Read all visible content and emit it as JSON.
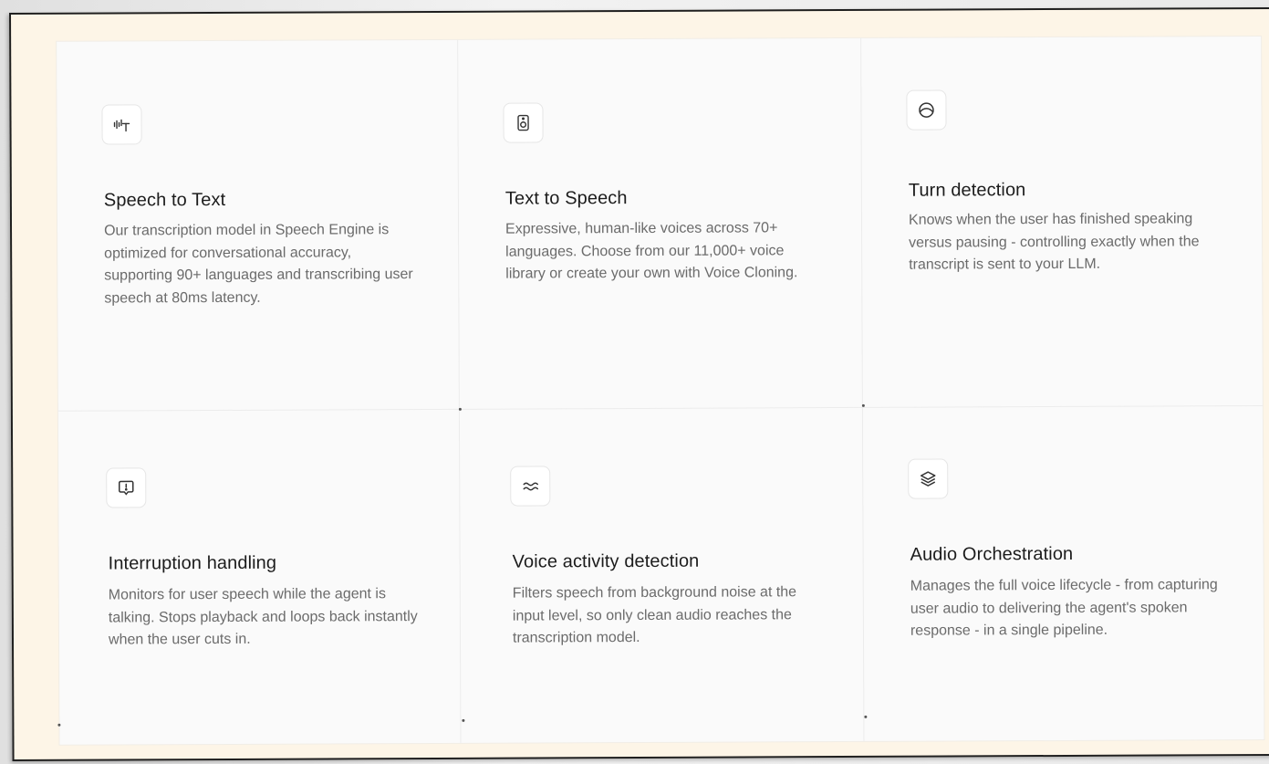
{
  "features": [
    {
      "icon": "speech-to-text-icon",
      "title": "Speech to Text",
      "description": "Our transcription model in Speech Engine is optimized for conversational accuracy, supporting 90+ languages and transcribing user speech at 80ms latency."
    },
    {
      "icon": "speaker-icon",
      "title": "Text to Speech",
      "description": "Expressive, human-like voices across 70+ languages. Choose from our 11,000+ voice library or create your own with Voice Cloning."
    },
    {
      "icon": "turn-detection-icon",
      "title": "Turn detection",
      "description": "Knows when the user has finished speaking versus pausing - controlling exactly when the transcript is sent to your LLM."
    },
    {
      "icon": "interruption-icon",
      "title": "Interruption handling",
      "description": "Monitors for user speech while the agent is talking. Stops playback and loops back instantly when the user cuts in."
    },
    {
      "icon": "waves-icon",
      "title": "Voice activity detection",
      "description": "Filters speech from background noise at the input level, so only clean audio reaches the transcription model."
    },
    {
      "icon": "layers-icon",
      "title": "Audio Orchestration",
      "description": "Manages the full voice lifecycle - from capturing user audio to delivering the agent's spoken response - in a single pipeline."
    }
  ]
}
